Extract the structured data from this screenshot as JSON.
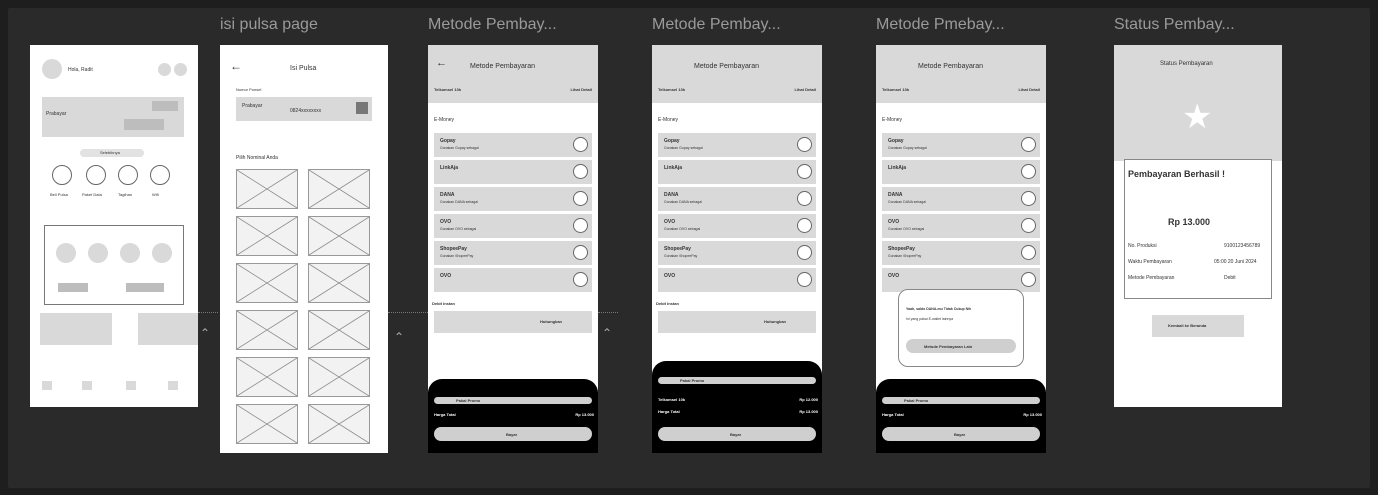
{
  "frames": {
    "home": {
      "greeting": "Hola, Radit",
      "provider": "Prabayar",
      "section_button": "Selebihnya",
      "menu": [
        "Beli Pulsa",
        "Paket Data",
        "Tagihan",
        "Wifi"
      ]
    },
    "pulsa": {
      "title": "isi pulsa page",
      "header": "Isi Pulsa",
      "phone_label": "Nomor Ponsel",
      "provider": "Prabayar",
      "phone_value": "0824xxxxxxxx",
      "nominal_label": "Pilih Nominal Anda"
    },
    "metode1": {
      "title": "Metode Pembay...",
      "header": "Metode Pembayaran",
      "product": "Telkomsel 10k",
      "detail": "Lihat Detail",
      "section": "E-Money",
      "debit": "Debit Instan",
      "connect": "Hubungkan",
      "promo": "Pakai Promo",
      "total_label": "Harga Total",
      "total": "Rp 13.000",
      "pay": "Bayar"
    },
    "metode2": {
      "title": "Metode Pembay...",
      "header": "Metode Pembayaran",
      "product": "Telkomsel 10k",
      "detail": "Lihat Detail",
      "section": "E-Money",
      "debit": "Debit Instan",
      "connect": "Hubungkan",
      "promo": "Pakai Promo",
      "line1_label": "Telkomsel 10k",
      "line1": "Rp 12.000",
      "total_label": "Harga Total",
      "total": "Rp 13.000",
      "pay": "Bayar"
    },
    "metode3": {
      "title": "Metode Pmebay...",
      "header": "Metode Pembayaran",
      "product": "Telkomsel 10k",
      "detail": "Lihat Detail",
      "section": "E-Money",
      "popup_title": "Yaah, saldo DANA-mu Tidak Cukup Nih",
      "popup_body": "Ini yang pakai E-wallet lainnya",
      "popup_button": "Metode Pembayaran Lain",
      "promo": "Pakai Promo",
      "total_label": "Harga Total",
      "total": "Rp 13.000",
      "pay": "Bayar"
    },
    "status": {
      "title": "Status Pembay...",
      "header": "Status Pembayaran",
      "success": "Pembayaran Berhasil !",
      "amount": "Rp 13.000",
      "rows": [
        {
          "label": "No. Produksi",
          "value": "9100123456789"
        },
        {
          "label": "Waktu Pembayaran",
          "value": "05:00 20 Juni 2024"
        },
        {
          "label": "Metode Pembayaran",
          "value": "Debit"
        }
      ],
      "back": "Kembali ke Beranda"
    }
  },
  "payment_methods": [
    {
      "name": "Gopay",
      "sub": "Gunakan Gopay sebagai"
    },
    {
      "name": "LinkAja",
      "sub": ""
    },
    {
      "name": "DANA",
      "sub": "Gunakan DANA sebagai"
    },
    {
      "name": "OVO",
      "sub": "Gunakan OVO sebagai"
    },
    {
      "name": "ShopeePay",
      "sub": "Gunakan ShopeePay"
    },
    {
      "name": "OVO",
      "sub": ""
    }
  ],
  "colors": {
    "canvas": "#1e1e1e",
    "frame": "#ffffff",
    "block": "#d9d9d9",
    "sheet": "#000000"
  }
}
